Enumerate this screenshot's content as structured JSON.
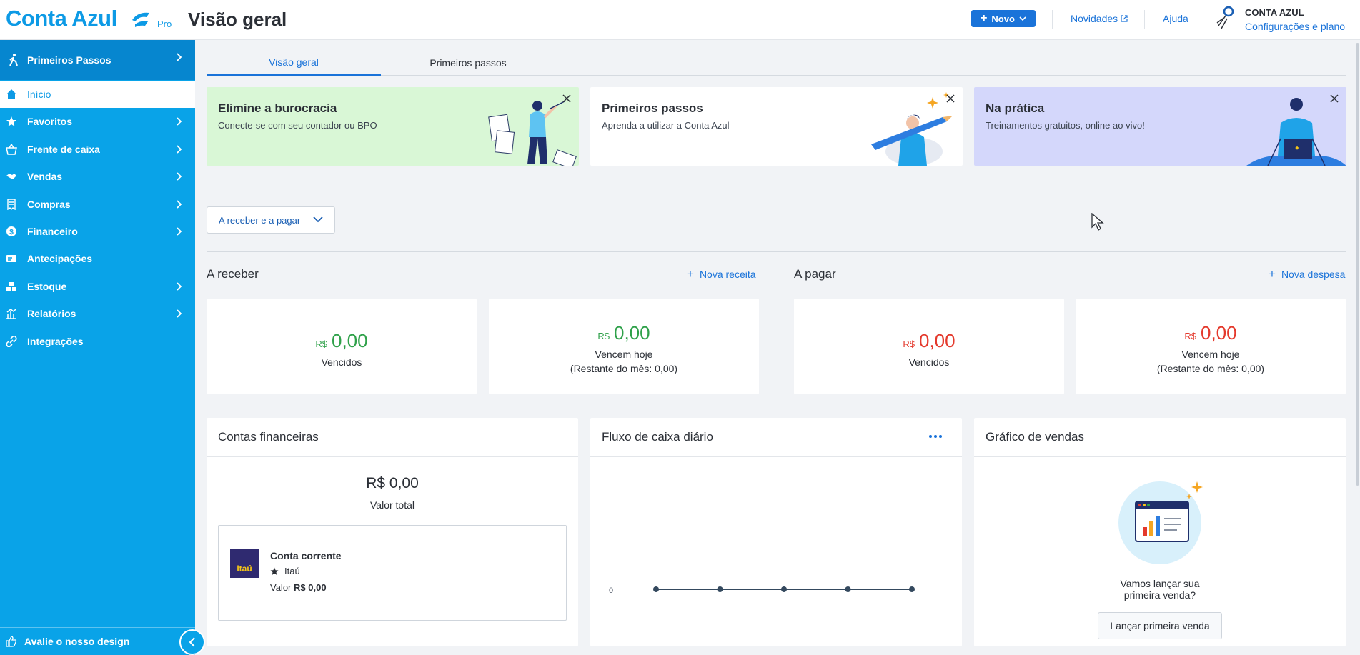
{
  "header": {
    "logo_text": "Conta Azul",
    "logo_badge": "Pro",
    "page_title": "Visão geral",
    "new_button": "Novo",
    "news_link": "Novidades",
    "help_link": "Ajuda",
    "user_name": "CONTA AZUL",
    "user_settings": "Configurações e plano"
  },
  "sidebar": {
    "first_steps": "Primeiros Passos",
    "items": [
      {
        "label": "Início",
        "icon": "home-icon",
        "active": true,
        "has_children": false
      },
      {
        "label": "Favoritos",
        "icon": "star-icon",
        "active": false,
        "has_children": true
      },
      {
        "label": "Frente de caixa",
        "icon": "basket-icon",
        "active": false,
        "has_children": true
      },
      {
        "label": "Vendas",
        "icon": "handshake-icon",
        "active": false,
        "has_children": true
      },
      {
        "label": "Compras",
        "icon": "receipt-icon",
        "active": false,
        "has_children": true
      },
      {
        "label": "Financeiro",
        "icon": "dollar-icon",
        "active": false,
        "has_children": true
      },
      {
        "label": "Antecipações",
        "icon": "card-icon",
        "active": false,
        "has_children": false
      },
      {
        "label": "Estoque",
        "icon": "boxes-icon",
        "active": false,
        "has_children": true
      },
      {
        "label": "Relatórios",
        "icon": "chart-icon",
        "active": false,
        "has_children": true
      },
      {
        "label": "Integrações",
        "icon": "link-icon",
        "active": false,
        "has_children": false
      }
    ],
    "feedback": "Avalie o nosso design"
  },
  "tabs": [
    "Visão geral",
    "Primeiros passos"
  ],
  "promos": [
    {
      "title": "Elimine a burocracia",
      "text": "Conecte-se com seu contador ou BPO",
      "bg": "#d9f7d6"
    },
    {
      "title": "Primeiros passos",
      "text": "Aprenda a utilizar a Conta Azul",
      "bg": "#ffffff"
    },
    {
      "title": "Na prática",
      "text": "Treinamentos gratuitos, online ao vivo!",
      "bg": "#d4d7fb"
    }
  ],
  "filter": {
    "label": "A receber e a pagar"
  },
  "receivable": {
    "title": "A receber",
    "action": "Nova receita",
    "overdue": {
      "currency": "R$",
      "value": "0,00",
      "label": "Vencidos"
    },
    "today": {
      "currency": "R$",
      "value": "0,00",
      "label": "Vencem hoje",
      "sub": "(Restante do mês: 0,00)"
    }
  },
  "payable": {
    "title": "A pagar",
    "action": "Nova despesa",
    "overdue": {
      "currency": "R$",
      "value": "0,00",
      "label": "Vencidos"
    },
    "today": {
      "currency": "R$",
      "value": "0,00",
      "label": "Vencem hoje",
      "sub": "(Restante do mês: 0,00)"
    }
  },
  "accounts": {
    "title": "Contas financeiras",
    "total": "R$ 0,00",
    "total_label": "Valor total",
    "account": {
      "name": "Conta corrente",
      "bank": "Itaú",
      "bank_logo": "Itaú",
      "value_label": "Valor",
      "value": "R$ 0,00"
    }
  },
  "cashflow": {
    "title": "Fluxo de caixa diário",
    "zero_label": "0",
    "points": [
      0,
      0,
      0,
      0,
      0
    ]
  },
  "sales": {
    "title": "Gráfico de vendas",
    "empty_text": "Vamos lançar sua primeira venda?",
    "button": "Lançar primeira venda"
  },
  "colors": {
    "sidebar": "#09a3e8",
    "accent": "#1a73d9",
    "positive": "#2fa14a",
    "negative": "#e4392c"
  }
}
